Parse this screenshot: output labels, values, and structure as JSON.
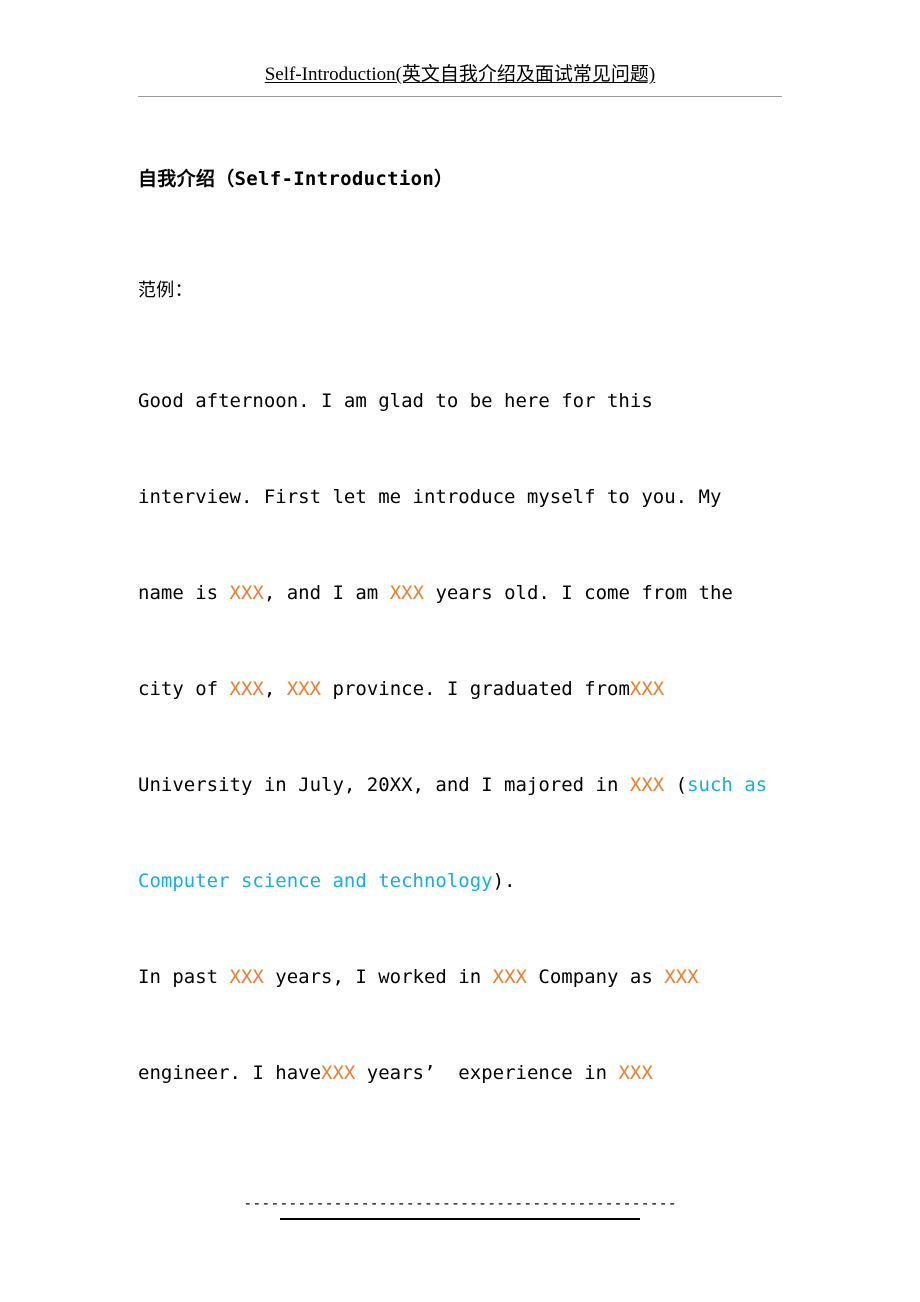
{
  "header": {
    "title": "Self-Introduction(英文自我介绍及面试常见问题)"
  },
  "document": {
    "heading": "自我介绍（Self-Introduction）",
    "subheading": "范例：",
    "lines": [
      {
        "id": "line-1",
        "segments": [
          {
            "text": "Good afternoon. I am glad to be here for this",
            "color": "black"
          }
        ]
      },
      {
        "id": "line-2",
        "segments": [
          {
            "text": "interview. First let me introduce myself to you. My",
            "color": "black"
          }
        ]
      },
      {
        "id": "line-3",
        "segments": [
          {
            "text": "name is ",
            "color": "black"
          },
          {
            "text": "XXX",
            "color": "orange"
          },
          {
            "text": ", and I am ",
            "color": "black"
          },
          {
            "text": "XXX",
            "color": "orange"
          },
          {
            "text": " years old. I come from the",
            "color": "black"
          }
        ]
      },
      {
        "id": "line-4",
        "segments": [
          {
            "text": "city of ",
            "color": "black"
          },
          {
            "text": "XXX",
            "color": "orange"
          },
          {
            "text": ", ",
            "color": "black"
          },
          {
            "text": "XXX",
            "color": "orange"
          },
          {
            "text": " province. I graduated from",
            "color": "black"
          },
          {
            "text": "XXX",
            "color": "orange"
          }
        ]
      },
      {
        "id": "line-5",
        "segments": [
          {
            "text": "University in July, 20XX, and I majored in ",
            "color": "black"
          },
          {
            "text": "XXX",
            "color": "orange"
          },
          {
            "text": " (",
            "color": "black"
          },
          {
            "text": "such as",
            "color": "blue"
          }
        ]
      },
      {
        "id": "line-6",
        "segments": [
          {
            "text": "Computer science and technology",
            "color": "blue"
          },
          {
            "text": ").",
            "color": "black"
          }
        ]
      },
      {
        "id": "line-7",
        "segments": [
          {
            "text": "In past ",
            "color": "black"
          },
          {
            "text": "XXX",
            "color": "orange"
          },
          {
            "text": " years, I worked in ",
            "color": "black"
          },
          {
            "text": "XXX",
            "color": "orange"
          },
          {
            "text": " Company as ",
            "color": "black"
          },
          {
            "text": "XXX",
            "color": "orange"
          }
        ]
      },
      {
        "id": "line-8",
        "segments": [
          {
            "text": "engineer. I have",
            "color": "black"
          },
          {
            "text": "XXX",
            "color": "orange"
          },
          {
            "text": " years’  experience in ",
            "color": "black"
          },
          {
            "text": "XXX",
            "color": "orange"
          }
        ]
      }
    ]
  },
  "footer": {
    "dashes": "------------------------------------------------"
  },
  "colors": {
    "placeholder_orange": "#ED7D31",
    "example_blue": "#15AEE5",
    "text_black": "#000000",
    "header_rule_gray": "#9a9a9a"
  }
}
